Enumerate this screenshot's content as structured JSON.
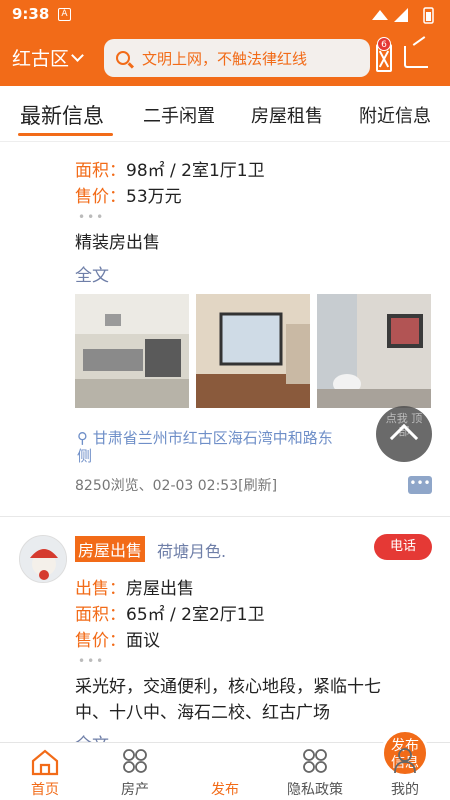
{
  "status_bar": {
    "time": "9:38",
    "app_icon_letter": "A"
  },
  "header": {
    "region": "红古区",
    "search_placeholder": "文明上网，不触法律红线",
    "message_badge": "6"
  },
  "tabs": [
    {
      "label": "最新信息",
      "active": true
    },
    {
      "label": "二手闲置",
      "active": false
    },
    {
      "label": "房屋租售",
      "active": false
    },
    {
      "label": "附近信息",
      "active": false
    }
  ],
  "post1": {
    "area_key": "面积",
    "area_val": "98㎡ / 2室1厅1卫",
    "price_key": "售价",
    "price_val": "53万元",
    "dots": "•••",
    "desc": "精装房出售",
    "full_text": "全文",
    "location": "甘肃省兰州市红古区海石湾中和路东侧",
    "meta": "8250浏览、02-03 02:53[刷新]"
  },
  "post2": {
    "tag": "房屋出售",
    "author": "荷塘月色.",
    "call_label": "电话",
    "type_key": "出售",
    "type_val": "房屋出售",
    "area_key": "面积",
    "area_val": "65㎡ / 2室2厅1卫",
    "price_key": "售价",
    "price_val": "面议",
    "dots": "•••",
    "desc1": "采光好，交通便利，核心地段，紧临十七",
    "desc2": "中、十八中、海石二校、红古广场",
    "full_text": "全文"
  },
  "float_button_label": "点我 顶部",
  "bottom_nav": {
    "home": "首页",
    "property": "房产",
    "publish_top": "发布",
    "publish_bottom": "信息",
    "publish_label": "发布",
    "privacy": "隐私政策",
    "mine": "我的"
  },
  "colors": {
    "brand": "#f26b18",
    "link": "#6f7fa8",
    "badge": "#e53935"
  }
}
